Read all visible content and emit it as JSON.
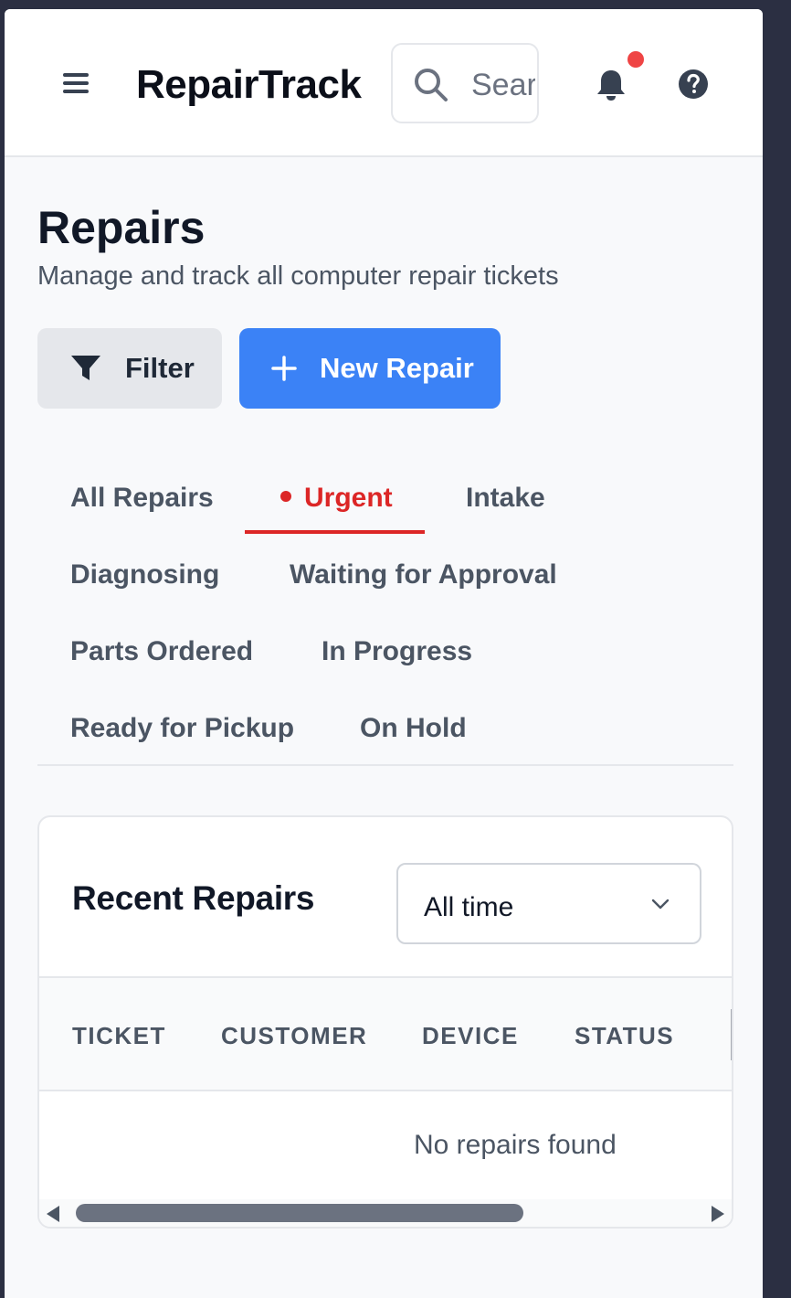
{
  "header": {
    "app_name": "RepairTrack",
    "search_placeholder": "Search repairs...",
    "notification_dot_color": "#ef4444",
    "icons": [
      "menu-icon",
      "search-icon",
      "bell-icon",
      "help-icon"
    ]
  },
  "page": {
    "title": "Repairs",
    "subtitle": "Manage and track all computer repair tickets"
  },
  "actions": {
    "filter_label": "Filter",
    "new_repair_label": "New Repair",
    "accent_color": "#3b82f6"
  },
  "tabs": [
    {
      "label": "All Repairs",
      "active": false
    },
    {
      "label": "Urgent",
      "active": true
    },
    {
      "label": "Intake",
      "active": false
    },
    {
      "label": "Diagnosing",
      "active": false
    },
    {
      "label": "Waiting for Approval",
      "active": false
    },
    {
      "label": "Parts Ordered",
      "active": false
    },
    {
      "label": "In Progress",
      "active": false
    },
    {
      "label": "Ready for Pickup",
      "active": false
    },
    {
      "label": "On Hold",
      "active": false
    }
  ],
  "recent": {
    "title": "Recent Repairs",
    "period_selected": "All time",
    "columns": [
      "TICKET",
      "CUSTOMER",
      "DEVICE",
      "STATUS"
    ],
    "empty_message": "No repairs found"
  }
}
